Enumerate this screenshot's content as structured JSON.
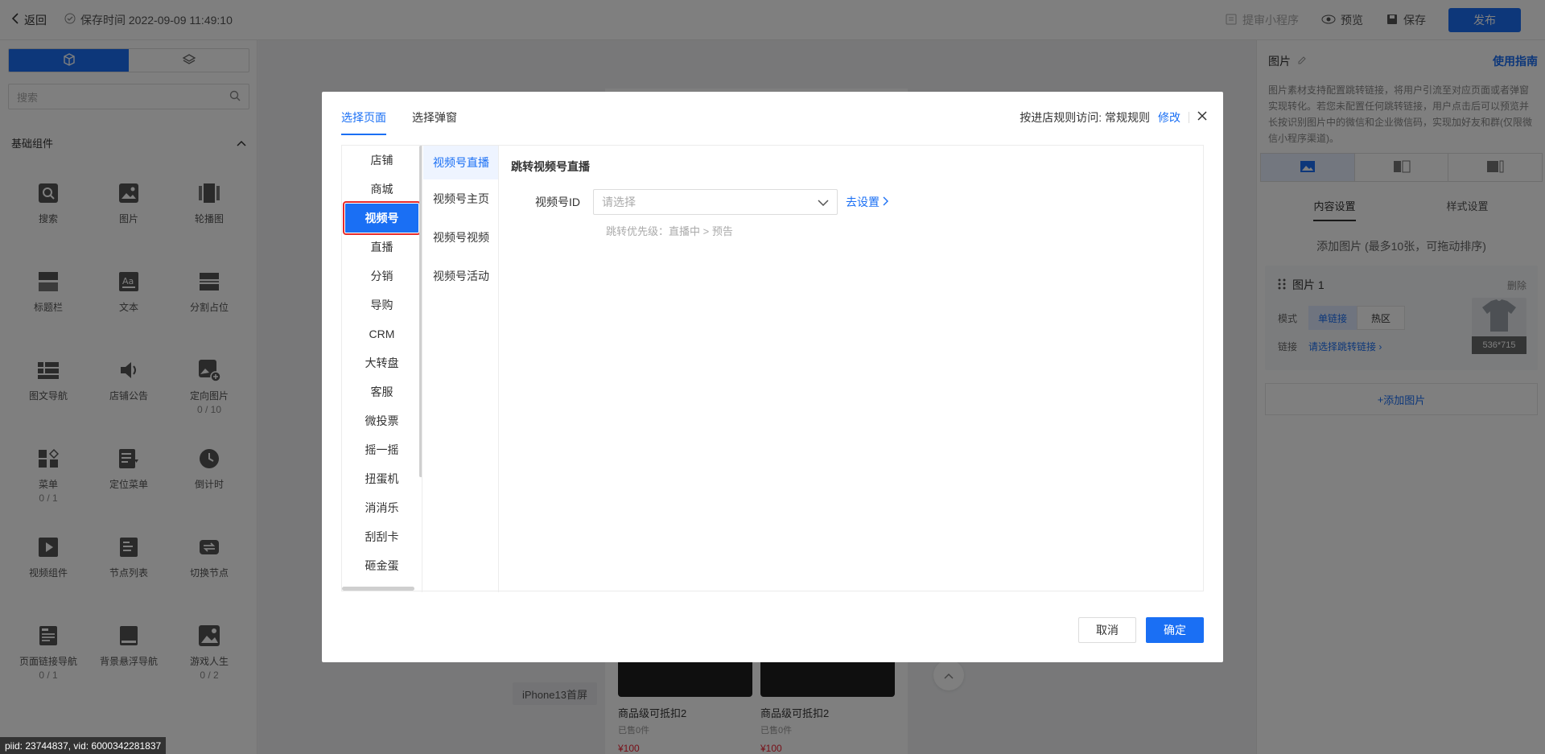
{
  "topbar": {
    "back_label": "返回",
    "saved_text": "保存时间 2022-09-09 11:49:10",
    "submit_label": "提审小程序",
    "preview_label": "预览",
    "save_label": "保存",
    "publish_label": "发布"
  },
  "left": {
    "search_placeholder": "搜索",
    "section_title": "基础组件",
    "components": [
      {
        "label": "搜索",
        "count": ""
      },
      {
        "label": "图片",
        "count": ""
      },
      {
        "label": "轮播图",
        "count": ""
      },
      {
        "label": "标题栏",
        "count": ""
      },
      {
        "label": "文本",
        "count": ""
      },
      {
        "label": "分割占位",
        "count": ""
      },
      {
        "label": "图文导航",
        "count": ""
      },
      {
        "label": "店铺公告",
        "count": ""
      },
      {
        "label": "定向图片",
        "count": "0 / 10"
      },
      {
        "label": "菜单",
        "count": "0 / 1"
      },
      {
        "label": "定位菜单",
        "count": ""
      },
      {
        "label": "倒计时",
        "count": ""
      },
      {
        "label": "视频组件",
        "count": ""
      },
      {
        "label": "节点列表",
        "count": ""
      },
      {
        "label": "切换节点",
        "count": ""
      },
      {
        "label": "页面链接导航",
        "count": "0 / 1"
      },
      {
        "label": "背景悬浮导航",
        "count": ""
      },
      {
        "label": "游戏人生",
        "count": "0 / 2"
      }
    ]
  },
  "canvas": {
    "device_label": "iPhone13首屏",
    "products": [
      {
        "name": "商品级可抵扣2",
        "sold": "已售0件",
        "price": "¥100"
      },
      {
        "name": "商品级可抵扣2",
        "sold": "已售0件",
        "price": "¥100"
      }
    ]
  },
  "right": {
    "title": "图片",
    "guide_label": "使用指南",
    "description": "图片素材支持配置跳转链接，将用户引流至对应页面或者弹窗实现转化。若您未配置任何跳转链接，用户点击后可以预览并长按识别图片中的微信和企业微信码，实现加好友和群(仅限微信小程序渠道)。",
    "tab_content": "内容设置",
    "tab_style": "样式设置",
    "add_hint": "添加图片 (最多10张，可拖动排序)",
    "card": {
      "title": "图片 1",
      "delete_label": "删除",
      "mode_label": "模式",
      "mode_single": "单链接",
      "mode_hotspot": "热区",
      "link_label": "链接",
      "link_value": "请选择跳转链接",
      "size": "536*715"
    },
    "add_button": "添加图片"
  },
  "debug": "piid: 23744837, vid: 6000342281837",
  "modal": {
    "tab_page": "选择页面",
    "tab_popup": "选择弹窗",
    "rule_text": "按进店规则访问: 常规规则",
    "rule_edit": "修改",
    "categories": [
      "店铺",
      "商城",
      "视频号",
      "直播",
      "分销",
      "导购",
      "CRM",
      "大转盘",
      "客服",
      "微投票",
      "摇一摇",
      "扭蛋机",
      "消消乐",
      "刮刮卡",
      "砸金蛋"
    ],
    "subcategories": [
      "视频号直播",
      "视频号主页",
      "视频号视频",
      "视频号活动"
    ],
    "content_title": "跳转视频号直播",
    "field_label": "视频号ID",
    "field_placeholder": "请选择",
    "setup_link": "去设置",
    "priority_hint": "跳转优先级：直播中 > 预告",
    "cancel_label": "取消",
    "confirm_label": "确定"
  }
}
